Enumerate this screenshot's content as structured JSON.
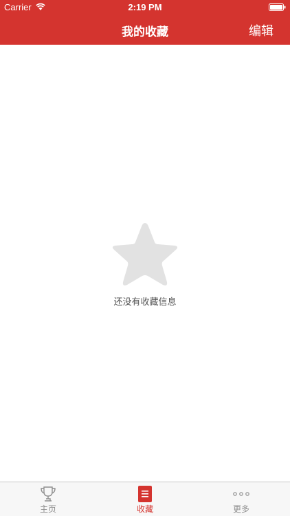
{
  "status_bar": {
    "carrier": "Carrier",
    "time": "2:19 PM"
  },
  "nav": {
    "title": "我的收藏",
    "edit_label": "编辑"
  },
  "empty_state": {
    "icon": "star-icon",
    "message": "还没有收藏信息"
  },
  "tabs": [
    {
      "label": "主页",
      "icon": "trophy-icon",
      "selected": false
    },
    {
      "label": "收藏",
      "icon": "list-icon",
      "selected": true
    },
    {
      "label": "更多",
      "icon": "more-dots-icon",
      "selected": false
    }
  ],
  "colors": {
    "accent": "#d4342f",
    "tab_inactive": "#8e8e8e",
    "empty_icon": "#e2e2e2"
  }
}
